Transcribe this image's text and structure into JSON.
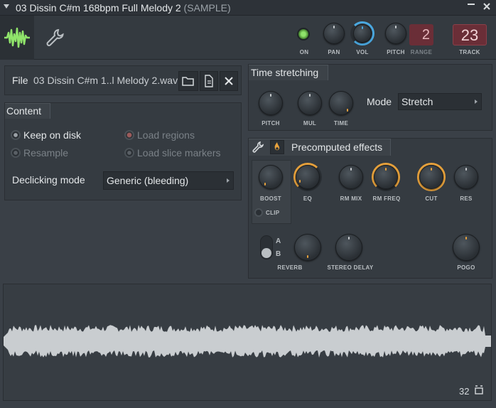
{
  "titlebar": {
    "title": "03 Dissin C#m 168bpm Full Melody 2",
    "suffix": "(SAMPLE)",
    "pin_icon": "pin-icon",
    "close_icon": "close-icon"
  },
  "toolbar": {
    "controls": {
      "on": "ON",
      "pan": "PAN",
      "vol": "VOL",
      "pitch": "PITCH",
      "range": "RANGE",
      "track": "TRACK"
    },
    "range_value": "2",
    "track_value": "23"
  },
  "file": {
    "label": "File",
    "name": "03 Dissin C#m 1..l Melody 2.wav"
  },
  "content": {
    "title": "Content",
    "options": {
      "keep_on_disk": "Keep on disk",
      "load_regions": "Load regions",
      "resample": "Resample",
      "load_slice_markers": "Load slice markers"
    },
    "declicking_label": "Declicking mode",
    "declicking_value": "Generic (bleeding)"
  },
  "time_stretching": {
    "title": "Time stretching",
    "knobs": {
      "pitch": "PITCH",
      "mul": "MUL",
      "time": "TIME"
    },
    "mode_label": "Mode",
    "mode_value": "Stretch"
  },
  "precomputed": {
    "title": "Precomputed effects",
    "knobs": {
      "boost": "BOOST",
      "eq": "EQ",
      "rm_mix": "RM MIX",
      "rm_freq": "RM FREQ",
      "cut": "CUT",
      "res": "RES",
      "reverb": "REVERB",
      "stereo_delay": "STEREO DELAY",
      "pogo": "POGO"
    },
    "clip_label": "CLIP",
    "switch_a": "A",
    "switch_b": "B"
  },
  "waveform": {
    "zoom_value": "32"
  },
  "colors": {
    "accent_orange": "#e8a23c",
    "accent_blue": "#4aa8e0",
    "led_green": "#8fe36a",
    "wave_fill": "#c9cdd0",
    "display_red": "#6a2e37"
  }
}
